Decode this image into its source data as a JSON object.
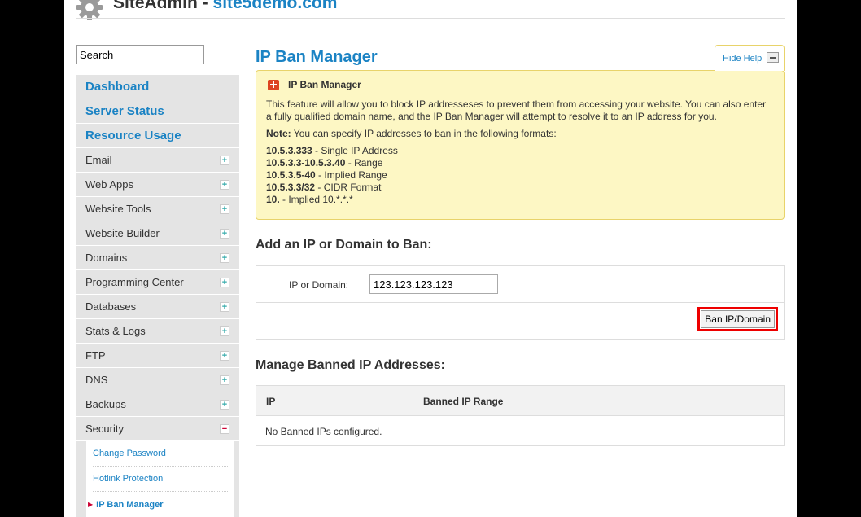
{
  "header": {
    "brand": "SiteAdmin - ",
    "domain": "site5demo.com"
  },
  "sidebar": {
    "search_placeholder": "Search",
    "primary": [
      {
        "label": "Dashboard"
      },
      {
        "label": "Server Status"
      },
      {
        "label": "Resource Usage"
      }
    ],
    "items": [
      {
        "label": "Email",
        "toggle": "+"
      },
      {
        "label": "Web Apps",
        "toggle": "+"
      },
      {
        "label": "Website Tools",
        "toggle": "+"
      },
      {
        "label": "Website Builder",
        "toggle": "+"
      },
      {
        "label": "Domains",
        "toggle": "+"
      },
      {
        "label": "Programming Center",
        "toggle": "+"
      },
      {
        "label": "Databases",
        "toggle": "+"
      },
      {
        "label": "Stats & Logs",
        "toggle": "+"
      },
      {
        "label": "FTP",
        "toggle": "+"
      },
      {
        "label": "DNS",
        "toggle": "+"
      },
      {
        "label": "Backups",
        "toggle": "+"
      },
      {
        "label": "Security",
        "toggle": "−"
      }
    ],
    "security_sub": [
      {
        "label": "Change Password"
      },
      {
        "label": "Hotlink Protection"
      },
      {
        "label": "IP Ban Manager"
      }
    ]
  },
  "main": {
    "title": "IP Ban Manager",
    "hide_help": "Hide Help",
    "help": {
      "title": "IP Ban Manager",
      "intro": "This feature will allow you to block IP addresseses to prevent them from accessing your website. You can also enter a fully qualified domain name, and the IP Ban Manager will attempt to resolve it to an IP address for you.",
      "note_label": "Note:",
      "note_text": " You can specify IP addresses to ban in the following formats:",
      "formats": [
        {
          "code": "10.5.3.333",
          "desc": " - Single IP Address"
        },
        {
          "code": "10.5.3.3-10.5.3.40",
          "desc": " - Range"
        },
        {
          "code": "10.5.3.5-40",
          "desc": " - Implied Range"
        },
        {
          "code": "10.5.3.3/32",
          "desc": " - CIDR Format"
        },
        {
          "code": "10.",
          "desc": " - Implied 10.*.*.*"
        }
      ]
    },
    "add_section": {
      "title": "Add an IP or Domain to Ban:",
      "field_label": "IP or Domain:",
      "field_value": "123.123.123.123",
      "button": "Ban IP/Domain"
    },
    "manage_section": {
      "title": "Manage Banned IP Addresses:",
      "columns": [
        "IP",
        "Banned IP Range"
      ],
      "empty": "No Banned IPs configured."
    }
  },
  "colors": {
    "accent": "#1b83c4",
    "help_bg": "#fdf7c4",
    "highlight": "#e00000"
  }
}
